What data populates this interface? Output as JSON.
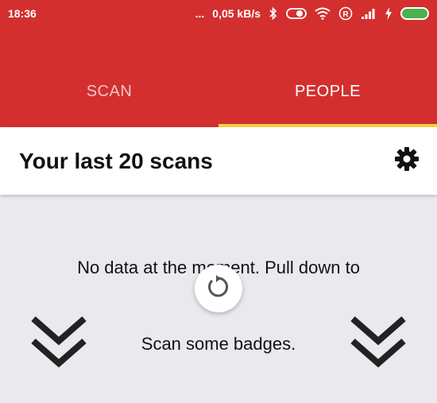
{
  "status_bar": {
    "time": "18:36",
    "dots": "...",
    "speed": "0,05 kB/s",
    "roaming": "R"
  },
  "tabs": [
    {
      "label": "SCAN",
      "active": false
    },
    {
      "label": "PEOPLE",
      "active": true
    }
  ],
  "header": {
    "title": "Your last 20 scans"
  },
  "empty_state": {
    "line1": "No data at the moment. Pull down to",
    "line2": "Scan some badges."
  },
  "colors": {
    "accent": "#d32f2f",
    "tab_indicator": "#f4d03f",
    "background": "#e9e9ee",
    "battery": "#4caf50"
  },
  "icons": {
    "settings": "gear-icon",
    "refresh": "refresh-icon",
    "pull_down": "double-chevron-down-icon"
  }
}
